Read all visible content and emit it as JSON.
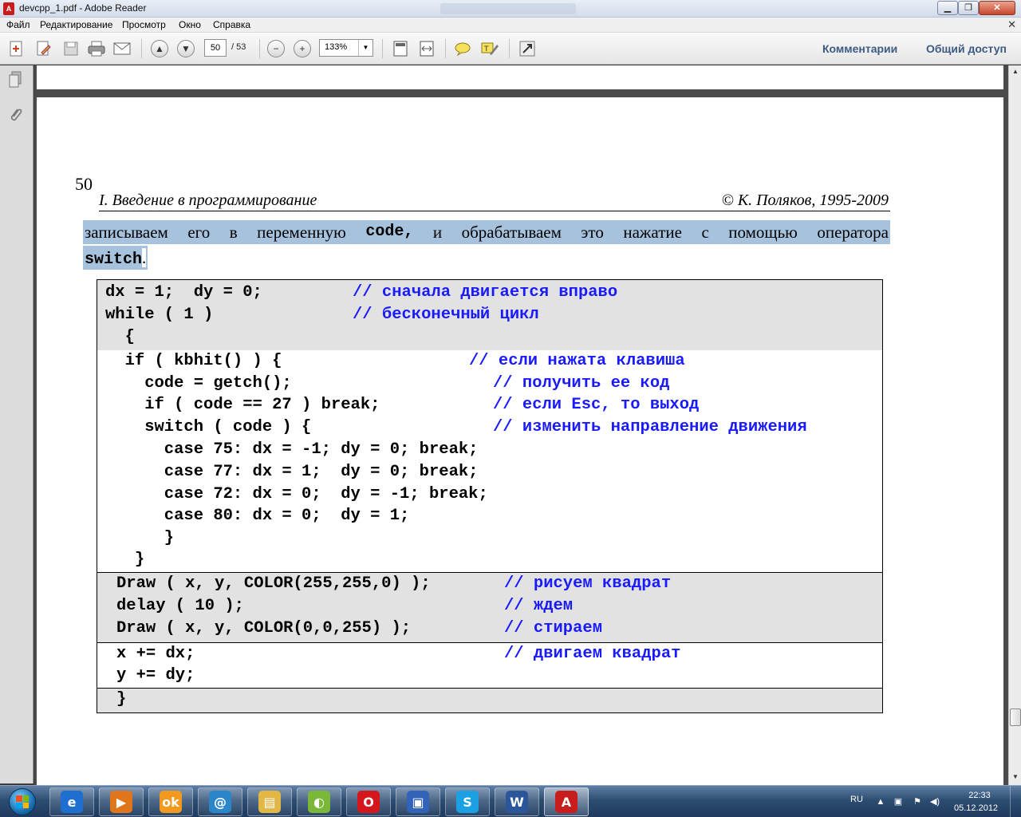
{
  "window": {
    "title": "devcpp_1.pdf - Adobe Reader",
    "app_icon_glyph": "A",
    "min_glyph": "▁",
    "max_glyph": "❐",
    "close_glyph": "✕"
  },
  "menu": {
    "items": [
      "Файл",
      "Редактирование",
      "Просмотр",
      "Окно",
      "Справка"
    ],
    "close_glyph": "✕"
  },
  "toolbar": {
    "current_page": "50",
    "total_pages": "/ 53",
    "zoom": "133%",
    "comments_label": "Комментарии",
    "share_label": "Общий доступ"
  },
  "icons": {
    "create": "create-pdf-icon",
    "edit": "edit-icon",
    "save": "save-icon",
    "print": "print-icon",
    "email": "email-icon",
    "prev": "previous-page-icon",
    "next": "next-page-icon",
    "zoom_out": "zoom-out-icon",
    "zoom_in": "zoom-in-icon",
    "fit_page": "fit-page-icon",
    "fit_width": "fit-width-icon",
    "sticky_note": "sticky-note-icon",
    "highlight": "highlight-icon",
    "full_screen": "full-screen-icon"
  },
  "page": {
    "number": "50",
    "header_left": "I. Введение в программирование",
    "header_right": "© К. Поляков, 1995-2009",
    "sel_line_1_words": [
      "записываем",
      "его",
      "в",
      "переменную",
      "code,",
      "и",
      "обрабатываем",
      "это",
      "нажатие",
      "с",
      "помощью",
      "оператора"
    ],
    "sel_line_2_code": "switch",
    "sel_line_2_rest": "."
  },
  "code": {
    "b1": [
      {
        "code": "dx = 1;  dy = 0;",
        "comment": "// сначала двигается вправо"
      },
      {
        "code": "while ( 1 )",
        "comment": "// бесконечный цикл"
      },
      {
        "code": "  {",
        "comment": ""
      }
    ],
    "b2": [
      {
        "code": "  if ( kbhit() ) {",
        "comment": "// если нажата клавиша"
      },
      {
        "code": "    code = getch();",
        "comment": "// получить ее код"
      },
      {
        "code": "    if ( code == 27 ) break;",
        "comment": "// если Esc, то выход"
      },
      {
        "code": "    switch ( code ) {",
        "comment": "// изменить направление движения"
      },
      {
        "code": "      case 75: dx = -1; dy = 0; break;",
        "comment": ""
      },
      {
        "code": "      case 77: dx = 1;  dy = 0; break;",
        "comment": ""
      },
      {
        "code": "      case 72: dx = 0;  dy = -1; break;",
        "comment": ""
      },
      {
        "code": "      case 80: dx = 0;  dy = 1;",
        "comment": ""
      },
      {
        "code": "      }",
        "comment": ""
      },
      {
        "code": "   }",
        "comment": ""
      }
    ],
    "b3": [
      {
        "code": "Draw ( x, y, COLOR(255,255,0) );",
        "comment": "// рисуем квадрат"
      },
      {
        "code": "delay ( 10 );",
        "comment": "// ждем"
      },
      {
        "code": "Draw ( x, y, COLOR(0,0,255) );",
        "comment": "// стираем"
      }
    ],
    "b4": [
      {
        "code": "x += dx;",
        "comment": "// двигаем квадрат"
      },
      {
        "code": "y += dy;",
        "comment": ""
      }
    ],
    "b5": [
      {
        "code": "}",
        "comment": ""
      }
    ]
  },
  "taskbar": {
    "apps": [
      {
        "name": "internet-explorer",
        "glyph": "e",
        "color": "#1e6fd0"
      },
      {
        "name": "media-player",
        "glyph": "▶",
        "color": "#e0761c"
      },
      {
        "name": "odnoklassniki",
        "glyph": "ok",
        "color": "#f39a1e"
      },
      {
        "name": "browser",
        "glyph": "@",
        "color": "#2a86c9"
      },
      {
        "name": "file-explorer",
        "glyph": "▤",
        "color": "#e2b746"
      },
      {
        "name": "color-app",
        "glyph": "◐",
        "color": "#7bb83a"
      },
      {
        "name": "opera",
        "glyph": "O",
        "color": "#d4171c"
      },
      {
        "name": "floppy-save",
        "glyph": "▣",
        "color": "#3263b8"
      },
      {
        "name": "skype",
        "glyph": "S",
        "color": "#1aa0e3"
      },
      {
        "name": "word",
        "glyph": "W",
        "color": "#2b579a"
      },
      {
        "name": "adobe-reader",
        "glyph": "A",
        "color": "#c91d1d"
      }
    ],
    "lang": "RU",
    "time": "22:33",
    "date": "05.12.2012",
    "tray_arrow": "▲",
    "tray_net": "▣",
    "tray_flag": "⚑",
    "tray_sound": "◀)"
  }
}
